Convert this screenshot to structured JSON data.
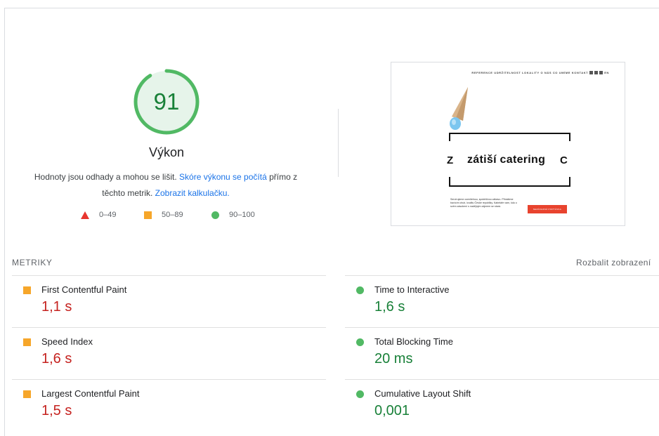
{
  "summary": {
    "score": "91",
    "title": "Výkon",
    "desc_text1": "Hodnoty jsou odhady a mohou se lišit. ",
    "desc_link1": "Skóre výkonu se počítá",
    "desc_text2": " přímo z těchto metrik. ",
    "desc_link2": "Zobrazit kalkulačku.",
    "legend": [
      {
        "range": "0–49",
        "icon": "triangle-icon",
        "color": "#e8352e"
      },
      {
        "range": "50–89",
        "icon": "square-icon",
        "color": "#f6a62a"
      },
      {
        "range": "90–100",
        "icon": "circle-icon",
        "color": "#51b964"
      }
    ]
  },
  "thumbnail": {
    "nav": "REFERENCE  UDRŽITELNOST  LOKALITY  O NÁS  CO UMÍME  KONTAKT",
    "lang": "EN",
    "logo_left": "Z",
    "logo_text": "zátiší catering",
    "logo_right": "C",
    "paragraph": "Servírujeme ocenitelnou, spolehlivou zábavu. Přinášíme bavícím chutí, kvalitu České republiky. Kabeláře vám, kdo o svém zásobení s nadějným zájmem se stará.",
    "button": "NEZÁVAZNÁ POPTÁVKA"
  },
  "metrics": {
    "label": "METRIKY",
    "expand": "Rozbalit zobrazení",
    "items": [
      {
        "name": "First Contentful Paint",
        "value": "1,1 s",
        "status": "average",
        "icon": "square-icon"
      },
      {
        "name": "Time to Interactive",
        "value": "1,6 s",
        "status": "pass",
        "icon": "circle-icon"
      },
      {
        "name": "Speed Index",
        "value": "1,6 s",
        "status": "average",
        "icon": "square-icon"
      },
      {
        "name": "Total Blocking Time",
        "value": "20 ms",
        "status": "pass",
        "icon": "circle-icon"
      },
      {
        "name": "Largest Contentful Paint",
        "value": "1,5 s",
        "status": "average",
        "icon": "square-icon"
      },
      {
        "name": "Cumulative Layout Shift",
        "value": "0,001",
        "status": "pass",
        "icon": "circle-icon"
      }
    ]
  },
  "colors": {
    "pass": "#188038",
    "average_value": "#c5221f",
    "link": "#1a73e8"
  }
}
